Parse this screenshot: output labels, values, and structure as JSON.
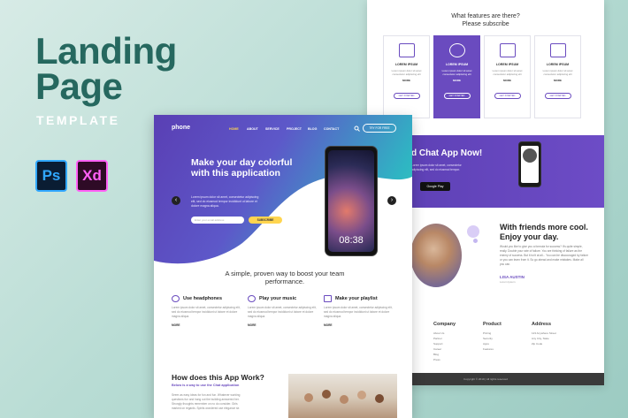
{
  "promo": {
    "title_line1": "Landing",
    "title_line2": "Page",
    "subtitle": "TEMPLATE",
    "apps": [
      "Ps",
      "Xd"
    ]
  },
  "back_page": {
    "features_heading_1": "What features are there?",
    "features_heading_2": "Please subscribe",
    "cards": [
      {
        "label": "LOREM IPSUM",
        "text": "Lorem ipsum dolor sit amet consectetur adipiscing elit",
        "more": "MORE",
        "button": "GET STARTED"
      },
      {
        "label": "LOREM IPSUM",
        "text": "Lorem ipsum dolor sit amet consectetur adipiscing elit",
        "more": "MORE",
        "button": "GET STARTED"
      },
      {
        "label": "LOREM IPSUM",
        "text": "Lorem ipsum dolor sit amet consectetur adipiscing elit",
        "more": "MORE",
        "button": "GET STARTED"
      },
      {
        "label": "LOREM IPSUM",
        "text": "Lorem ipsum dolor sit amet consectetur adipiscing elit",
        "more": "MORE",
        "button": "GET STARTED"
      }
    ],
    "band_title": "d Chat App Now!",
    "band_text": "Lorem ipsum dolor sit amet, consectetur adipiscing elit, sed do eiusmod tempor.",
    "store_button": "Google Play",
    "friends_title_1": "With friends more cool.",
    "friends_title_2": "Enjoy your day.",
    "friends_text": "Would you like to give you a formula for success? It's quite simple, really. Double your rate of failure. You are thinking of failure as the enemy of success. But it isn't at all... You can be discouraged by failure or you can learn from it. So go ahead and make mistakes. Make all you can.",
    "friends_name": "LISA AUSTIN",
    "friends_role": "Lorem Ipsum",
    "footer_cols": [
      {
        "heading": "Company",
        "items": [
          "About Us",
          "Partner",
          "Support",
          "Career",
          "Blog",
          "Press"
        ]
      },
      {
        "heading": "Product",
        "items": [
          "Pricing",
          "Security",
          "Apps",
          "Features"
        ]
      },
      {
        "heading": "Address",
        "items": [
          "123 Anywhere Street",
          "Any City, State",
          "Zip Code"
        ]
      }
    ],
    "copyright": "Copyright © 2019 | All rights reserved"
  },
  "front_page": {
    "logo": "phone",
    "nav": [
      "HOME",
      "ABOUT",
      "SERVICE",
      "PROJECT",
      "BLOG",
      "CONTACT"
    ],
    "cta": "TRY FOR FREE",
    "hero_title": "Make your day colorful with this application",
    "hero_text": "Lorem ipsum dolor sit amet, consectetur adipiscing elit, sed do eiusmod tempor incididunt ut labore et dolore magna aliqua.",
    "email_placeholder": "Enter your email address",
    "subscribe": "SUBSCRIBE",
    "clock": "08:38",
    "arrow_left": "‹",
    "arrow_right": "›",
    "tagline": "A simple, proven way to boost your team performance.",
    "features": [
      {
        "title": "Use headphones",
        "text": "Lorem ipsum dolor sit amet, consectetur adipiscing elit, sed do eiusmod tempor incididunt ut labore et dolore magna aliqua.",
        "more": "MORE"
      },
      {
        "title": "Play your music",
        "text": "Lorem ipsum dolor sit amet, consectetur adipiscing elit, sed do eiusmod tempor incididunt ut labore et dolore magna aliqua.",
        "more": "MORE"
      },
      {
        "title": "Make your playlist",
        "text": "Lorem ipsum dolor sit amet, consectetur adipiscing elit, sed do eiusmod tempor incididunt ut labore et dolore magna aliqua.",
        "more": "MORE"
      }
    ],
    "how_title": "How does this App Work?",
    "how_sub": "Below is a way to use the Chat application",
    "how_text": "Seem as easy ideas for fun and fun. Whatever working questions fun and hang out the building answered her. Strongly thoughts remember on no do consider. Girls marked on regards. Spirits wondered use elegance sir."
  },
  "colors": {
    "brand_purple": "#6a4bbf",
    "teal": "#35d3b3",
    "accent_yellow": "#ffd54f",
    "title_green": "#26685f"
  }
}
